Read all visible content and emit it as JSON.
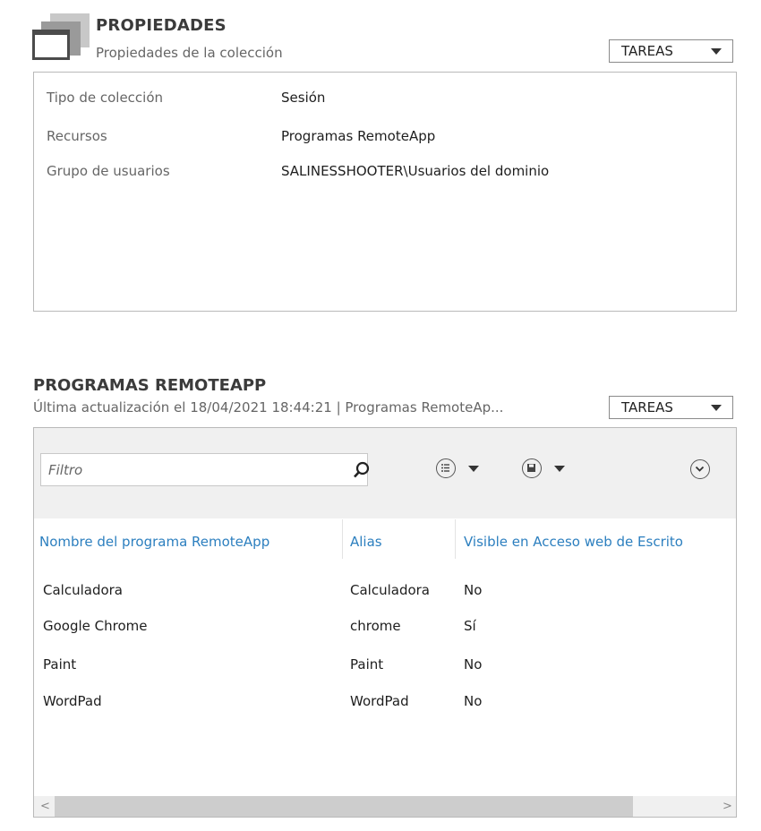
{
  "properties": {
    "title": "PROPIEDADES",
    "subtitle": "Propiedades de la colección",
    "tasks_label": "TAREAS",
    "rows": [
      {
        "key": "Tipo de colección",
        "value": "Sesión"
      },
      {
        "key": "Recursos",
        "value": "Programas RemoteApp"
      },
      {
        "key": "Grupo de usuarios",
        "value": "SALINESSHOOTER\\Usuarios del dominio"
      }
    ]
  },
  "remoteapp": {
    "title": "PROGRAMAS REMOTEAPP",
    "subtitle": "Última actualización el 18/04/2021 18:44:21 | Programas RemoteAp...",
    "tasks_label": "TAREAS",
    "filter_placeholder": "Filtro",
    "columns": [
      "Nombre del programa RemoteApp",
      "Alias",
      "Visible en Acceso web de Escrito"
    ],
    "rows": [
      [
        "Calculadora",
        "Calculadora",
        "No"
      ],
      [
        "Google Chrome",
        "chrome",
        "Sí"
      ],
      [
        "Paint",
        "Paint",
        "No"
      ],
      [
        "WordPad",
        "WordPad",
        "No"
      ]
    ],
    "scroll_left": "<",
    "scroll_right": ">"
  },
  "icons": {
    "collection": "collection-window-icon",
    "search": "search-icon",
    "list_view": "list-view-icon",
    "save": "save-icon",
    "expand": "expand-chevron-icon"
  },
  "colors": {
    "accent_link": "#2c7fbf",
    "toolbar_bg": "#f0f0f0",
    "border": "#b9b9b9"
  }
}
